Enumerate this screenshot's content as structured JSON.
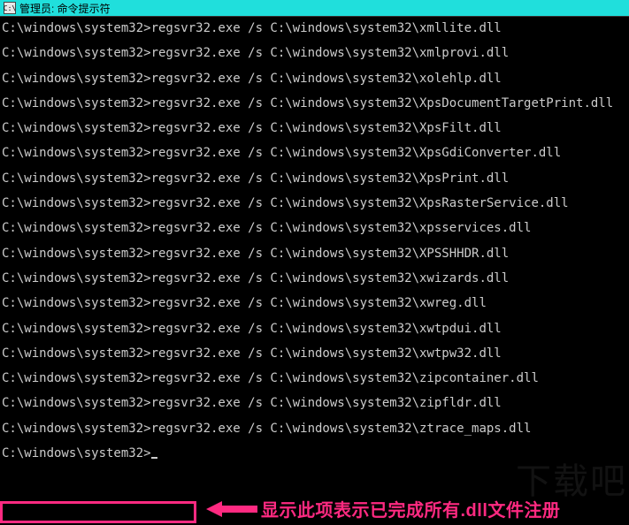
{
  "titlebar": {
    "icon_text": "C:\\",
    "title": "管理员: 命令提示符"
  },
  "terminal": {
    "prompt": "C:\\windows\\system32>",
    "cmd_prefix": "regsvr32.exe /s C:\\windows\\system32\\",
    "files": [
      "xmllite.dll",
      "xmlprovi.dll",
      "xolehlp.dll",
      "XpsDocumentTargetPrint.dll",
      "XpsFilt.dll",
      "XpsGdiConverter.dll",
      "XpsPrint.dll",
      "XpsRasterService.dll",
      "xpsservices.dll",
      "XPSSHHDR.dll",
      "xwizards.dll",
      "xwreg.dll",
      "xwtpdui.dll",
      "xwtpw32.dll",
      "zipcontainer.dll",
      "zipfldr.dll",
      "ztrace_maps.dll"
    ],
    "final_prompt": "C:\\windows\\system32>"
  },
  "annotation": {
    "text": "显示此项表示已完成所有.dll文件注册"
  },
  "watermark": "下载吧"
}
